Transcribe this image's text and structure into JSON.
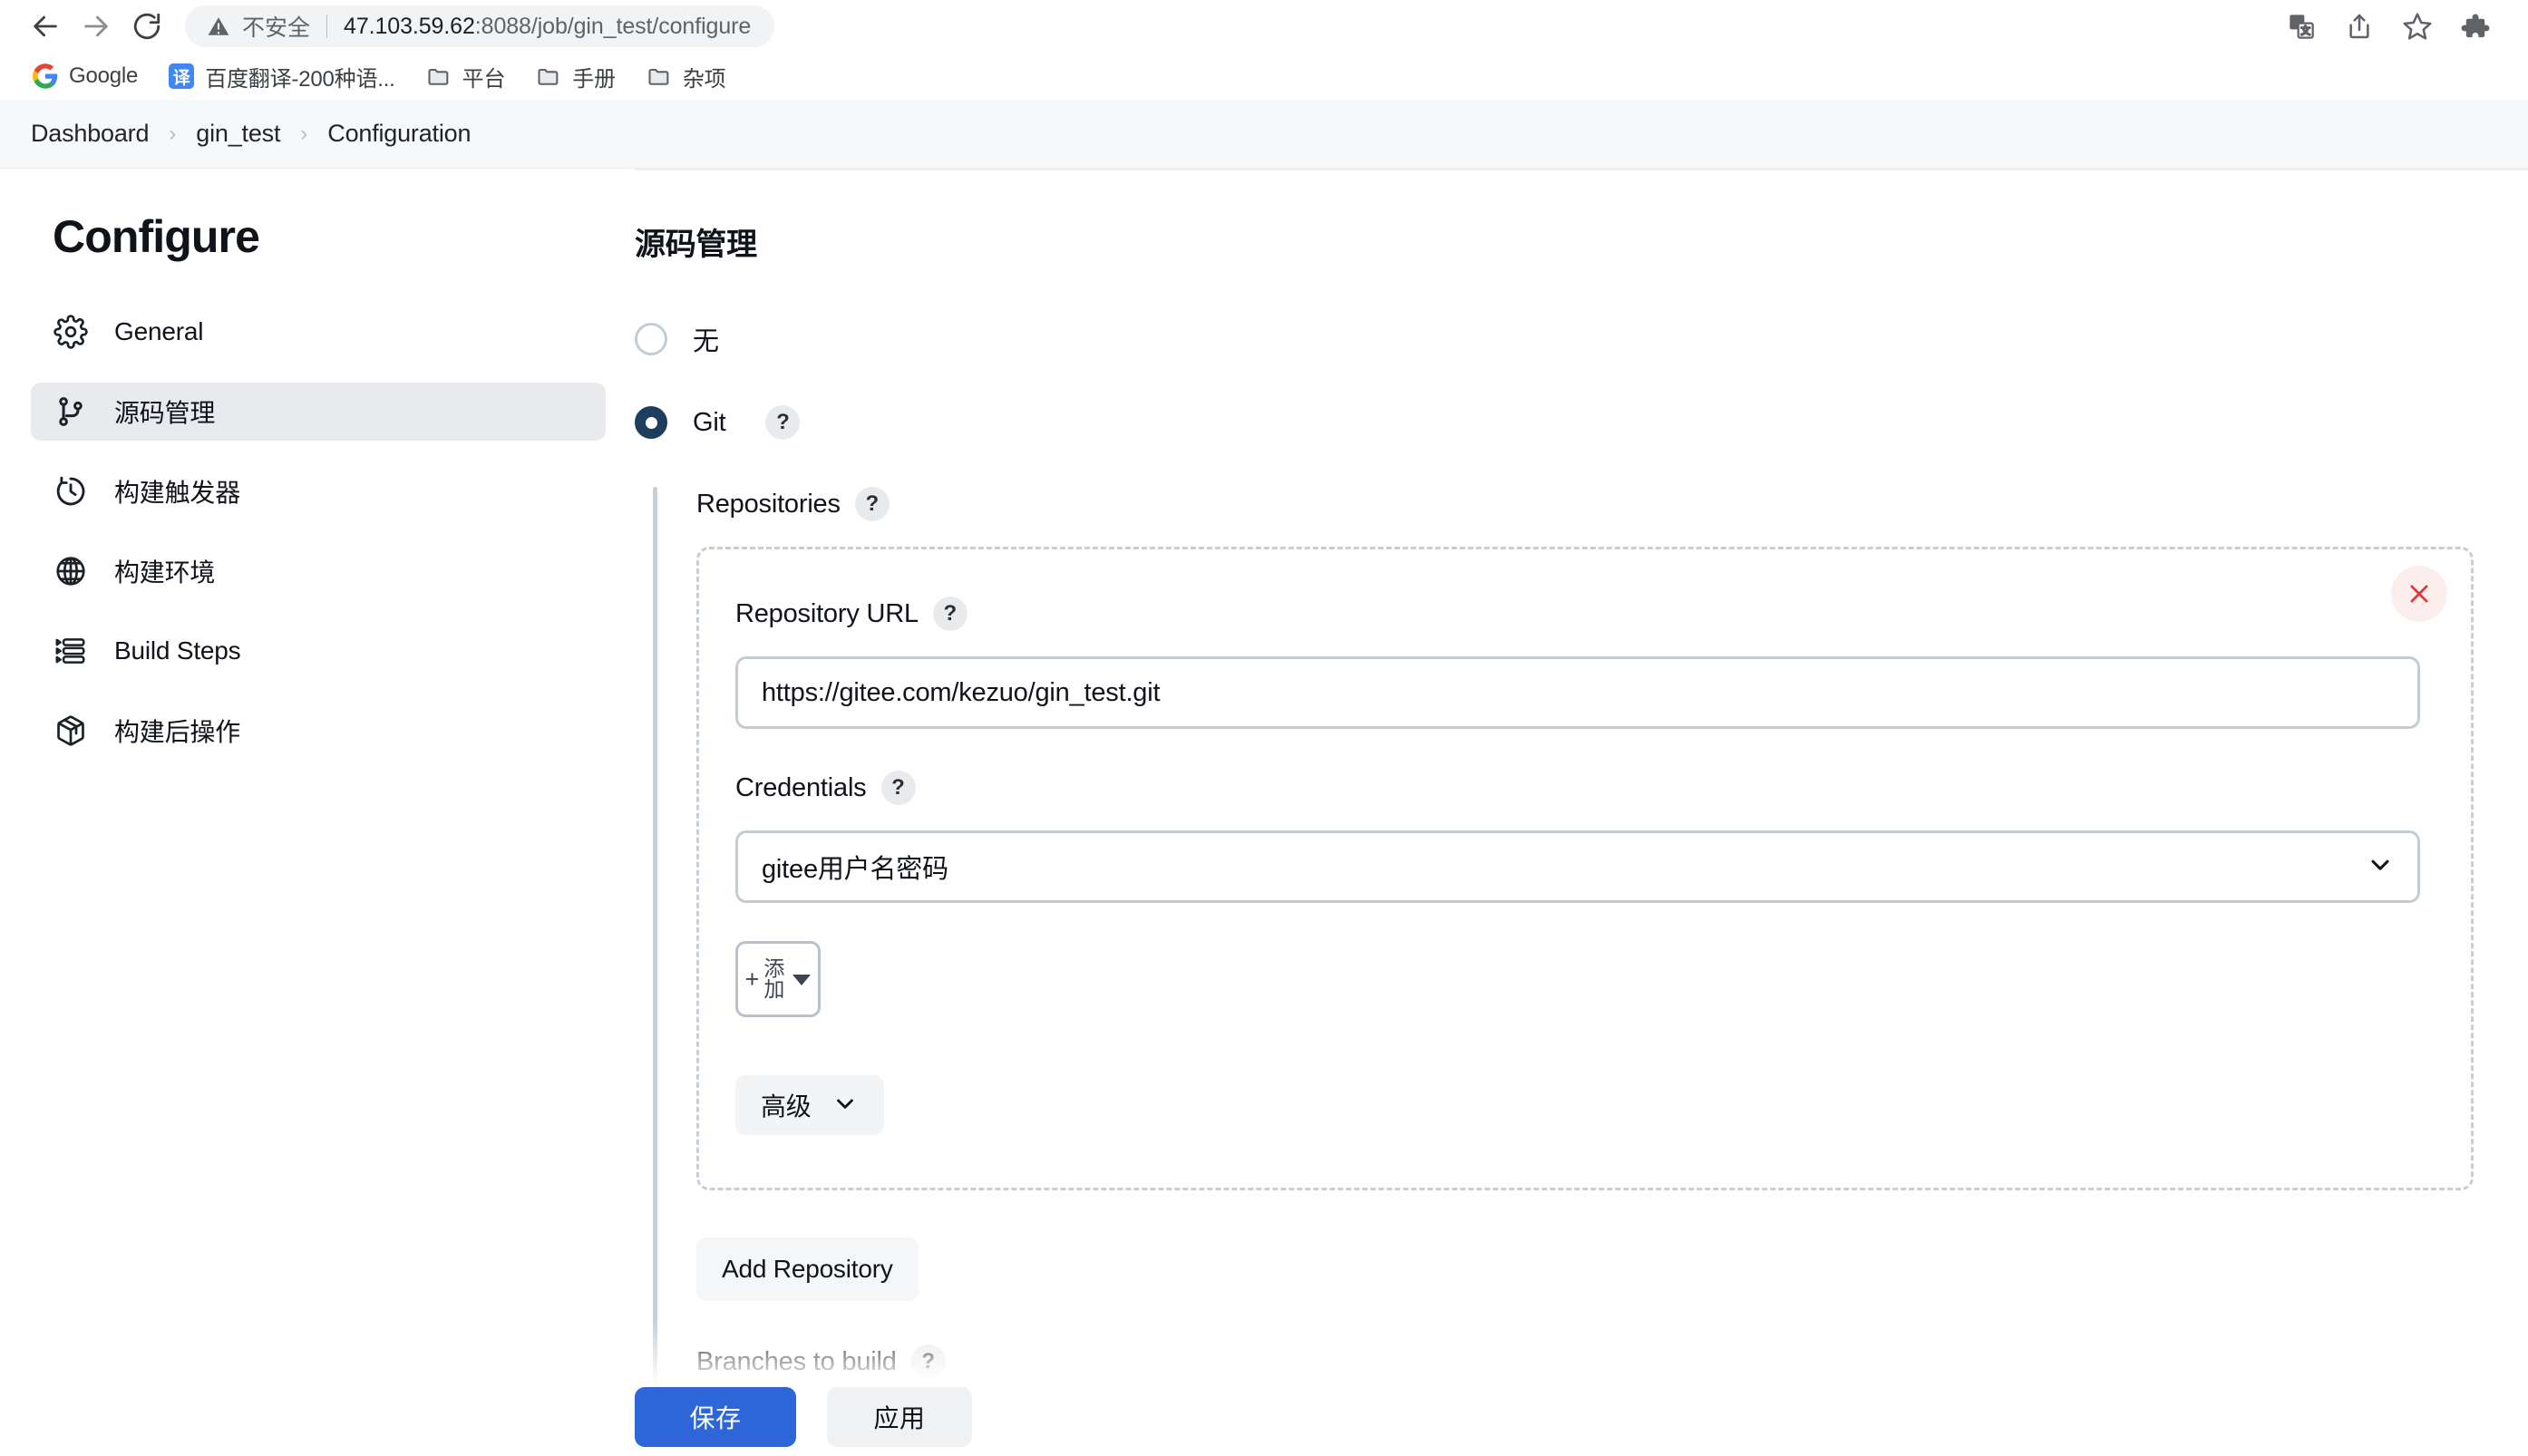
{
  "browser": {
    "back_icon": "back-arrow-icon",
    "forward_icon": "forward-arrow-icon",
    "reload_icon": "reload-icon",
    "security_label": "不安全",
    "url_host": "47.103.59.62",
    "url_path": ":8088/job/gin_test/configure",
    "right_icons": [
      "translate-icon",
      "share-icon",
      "bookmark-star-icon",
      "extensions-puzzle-icon"
    ],
    "bookmarks": [
      {
        "label": "Google",
        "icon": "google-favicon"
      },
      {
        "label": "百度翻译-200种语...",
        "icon": "baidu-translate-favicon"
      },
      {
        "label": "平台",
        "icon": "folder-icon"
      },
      {
        "label": "手册",
        "icon": "folder-icon"
      },
      {
        "label": "杂项",
        "icon": "folder-icon"
      }
    ]
  },
  "breadcrumb": {
    "items": [
      "Dashboard",
      "gin_test",
      "Configuration"
    ],
    "separator": "›"
  },
  "sidebar": {
    "title": "Configure",
    "items": [
      {
        "label": "General",
        "icon": "gear-icon",
        "active": false
      },
      {
        "label": "源码管理",
        "icon": "source-branch-icon",
        "active": true
      },
      {
        "label": "构建触发器",
        "icon": "clock-icon",
        "active": false
      },
      {
        "label": "构建环境",
        "icon": "globe-icon",
        "active": false
      },
      {
        "label": "Build Steps",
        "icon": "steps-list-icon",
        "active": false
      },
      {
        "label": "构建后操作",
        "icon": "package-box-icon",
        "active": false
      }
    ]
  },
  "main": {
    "heading": "源码管理",
    "scm_options": [
      {
        "label": "无",
        "selected": false,
        "has_help": false
      },
      {
        "label": "Git",
        "selected": true,
        "has_help": true
      }
    ],
    "help_glyph": "?",
    "repositories_label": "Repositories",
    "repository": {
      "url_label": "Repository URL",
      "url_value": "https://gitee.com/kezuo/gin_test.git",
      "url_placeholder": "",
      "credentials_label": "Credentials",
      "credentials_value": "gitee用户名密码",
      "add_credentials_plus": "+",
      "add_credentials_label": "添加",
      "advanced_label": "高级",
      "delete_icon": "close-x-icon"
    },
    "add_repository_label": "Add Repository",
    "branches_label": "Branches to build"
  },
  "footer": {
    "save_label": "保存",
    "apply_label": "应用"
  },
  "colors": {
    "accent_blue": "#2c66d9",
    "radio_selected": "#1d3e5e",
    "sidebar_active_bg": "#e8eaee",
    "delete_red": "#d93a3a",
    "delete_bg": "#fdeeee",
    "breadcrumb_bg": "#f7f8f9"
  }
}
